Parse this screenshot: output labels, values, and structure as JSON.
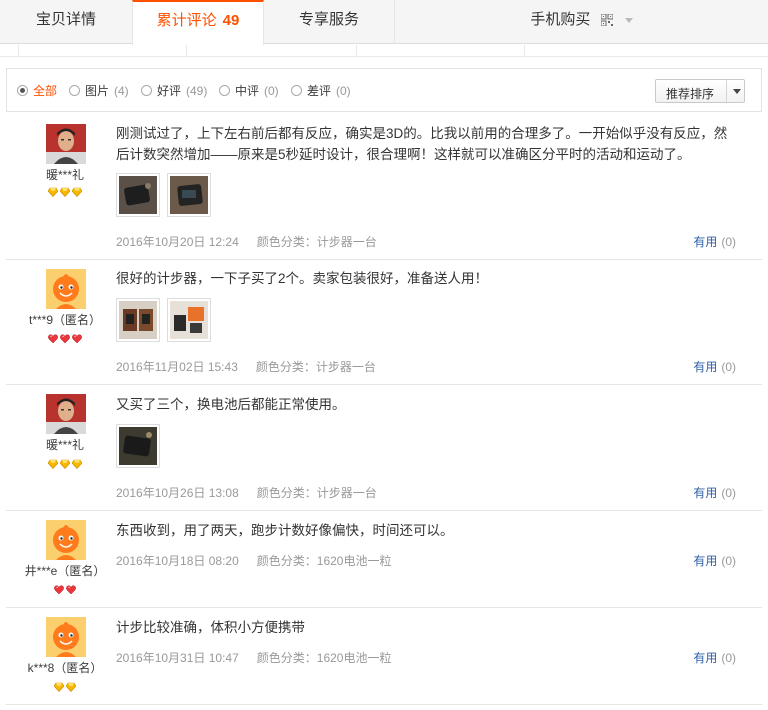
{
  "tabs": [
    {
      "label": "宝贝详情",
      "count": ""
    },
    {
      "label": "累计评论",
      "count": "49"
    },
    {
      "label": "专享服务",
      "count": ""
    },
    {
      "label": "手机购买",
      "count": ""
    }
  ],
  "filters": [
    {
      "label": "全部",
      "count": ""
    },
    {
      "label": "图片",
      "count": "(4)"
    },
    {
      "label": "好评",
      "count": "(49)"
    },
    {
      "label": "中评",
      "count": "(0)"
    },
    {
      "label": "差评",
      "count": "(0)"
    }
  ],
  "sort_label": "推荐排序",
  "useful_label": "有用",
  "reviews": [
    {
      "user": "暖***礼",
      "avatar": "photo-avatar",
      "badge_icon": "gold-diamond-icon",
      "content": "刚测试过了，上下左右前后都有反应，确实是3D的。比我以前用的合理多了。一开始似乎没有反应，然后计数突然增加——原来是5秒延时设计，很合理啊！这样就可以准确区分平时的活动和运动了。",
      "date": "2016年10月20日 12:24",
      "spec": "颜色分类：计步器一台",
      "useful_count": "(0)"
    },
    {
      "user": "t***9（匿名）",
      "avatar": "default-avatar",
      "badge_icon": "red-heart-icon",
      "content": "很好的计步器，一下子买了2个。卖家包装很好，准备送人用！",
      "date": "2016年11月02日 15:43",
      "spec": "颜色分类：计步器一台",
      "useful_count": "(0)"
    },
    {
      "user": "暖***礼",
      "avatar": "photo-avatar",
      "badge_icon": "gold-diamond-icon",
      "content": "又买了三个，换电池后都能正常使用。",
      "date": "2016年10月26日 13:08",
      "spec": "颜色分类：计步器一台",
      "useful_count": "(0)"
    },
    {
      "user": "井***e（匿名）",
      "avatar": "default-avatar",
      "badge_icon": "red-heart-icon",
      "content": "东西收到，用了两天，跑步计数好像偏快，时间还可以。",
      "date": "2016年10月18日 08:20",
      "spec": "颜色分类：1620电池一粒",
      "useful_count": "(0)"
    },
    {
      "user": "k***8（匿名）",
      "avatar": "default-avatar",
      "badge_icon": "gold-diamond-icon",
      "content": "计步比较准确，体积小方便携带",
      "date": "2016年10月31日 10:47",
      "spec": "颜色分类：1620电池一粒",
      "useful_count": "(0)"
    }
  ],
  "colors": {
    "accent": "#ff5000",
    "link": "#2f5fa7",
    "muted": "#999999"
  }
}
